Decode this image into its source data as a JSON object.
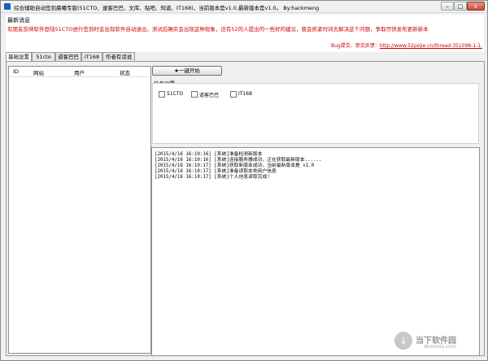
{
  "window": {
    "title": "综合辅助自动签到晨曦专版(51CTO、速客巴巴、文库、贴吧、知道、IT168)，当前版本是v1.0,最新版本是v1.0。 By:hackmeng",
    "min_label": "–",
    "max_label": "□",
    "close_label": "x"
  },
  "news": {
    "title": "最新消息",
    "message": "有朋友反映软件登陆51CTO进行签到时会出现软件自动退出，测试后确实会出现这种现象，还有52的人提出的一些好的建议，我会抓紧时间去解决这个问题，争取尽快发布更新新本",
    "feedback_label": "Bug提交、意见反馈：",
    "feedback_link": "http://www.52pojie.cn/thread-351098-1-1."
  },
  "tabs": [
    {
      "label": "基础设置"
    },
    {
      "label": "51cto"
    },
    {
      "label": "道客巴巴"
    },
    {
      "label": "IT168"
    },
    {
      "label": "作者有话说"
    }
  ],
  "list": {
    "columns": [
      "ID",
      "网站",
      "用户",
      "状态"
    ]
  },
  "start_button": {
    "icon": "star-icon",
    "label": "一键开始"
  },
  "tasks": {
    "title": "任务设置",
    "items": [
      {
        "label": "51CTO",
        "checked": false
      },
      {
        "label": "道客巴巴",
        "checked": false
      },
      {
        "label": "IT168",
        "checked": false
      }
    ]
  },
  "log": [
    "[2015/4/16 16:10:16] [系统]准备检测新版本",
    "[2015/4/16 16:10:16] [系统]连接服务器成功，正在获取最新版本......",
    "[2015/4/16 16:10:17] [系统]获取新版本成功，当前最新版本是 v1.0",
    "[2015/4/16 16:10:17] [系统]准备读取本地用户信息",
    "[2015/4/16 16:10:17] [系统]个人信息读取完成!"
  ],
  "watermark": {
    "brand": "当下软件园",
    "site": "downxia.com"
  }
}
